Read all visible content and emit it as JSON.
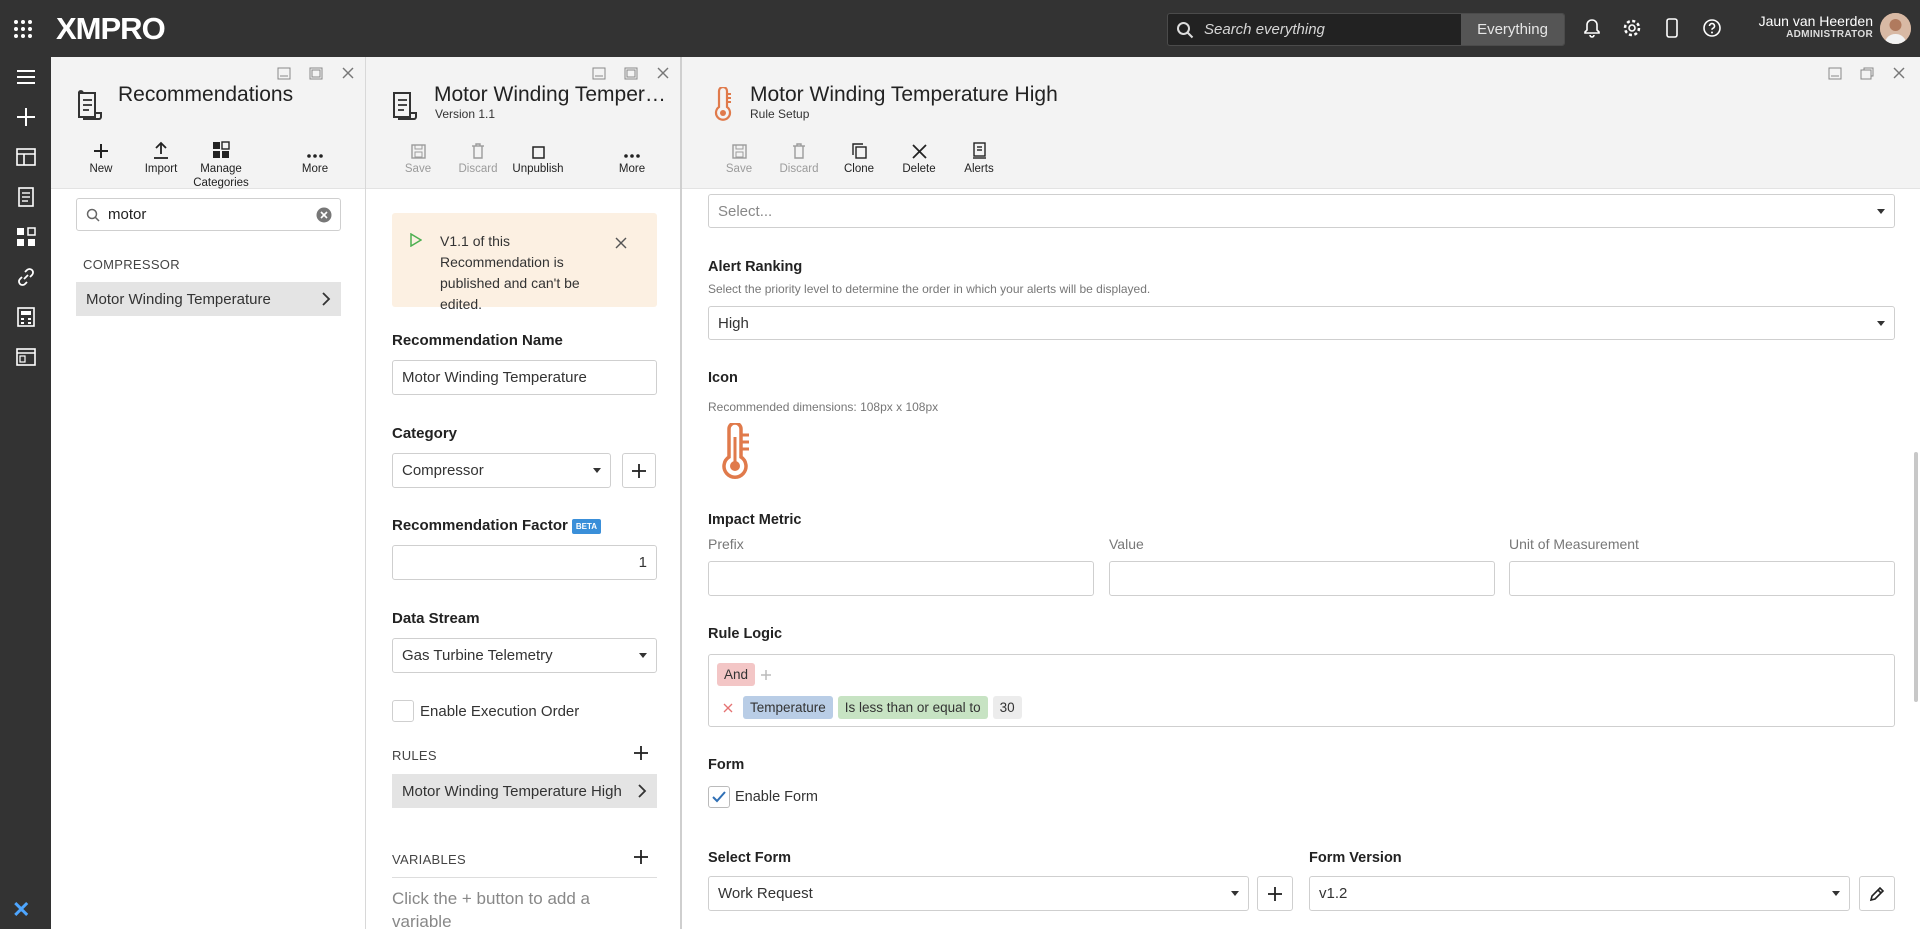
{
  "app": {
    "logo": "XMPRO"
  },
  "topbar": {
    "search_placeholder": "Search everything",
    "search_scope": "Everything",
    "user_name": "Jaun van Heerden",
    "user_role": "ADMINISTRATOR"
  },
  "recommendations_panel": {
    "title": "Recommendations",
    "toolbar": {
      "new": "New",
      "import": "Import",
      "manage_categories": "Manage Categories",
      "more": "More"
    },
    "search_value": "motor",
    "group": "COMPRESSOR",
    "items": [
      "Motor Winding Temperature"
    ]
  },
  "recommendation_panel": {
    "title": "Motor Winding Temper…",
    "version": "Version 1.1",
    "toolbar": {
      "save": "Save",
      "discard": "Discard",
      "unpublish": "Unpublish",
      "more": "More"
    },
    "banner": "V1.1 of this Recommendation is published and can't be edited.",
    "name_label": "Recommendation Name",
    "name_value": "Motor Winding Temperature",
    "category_label": "Category",
    "category_value": "Compressor",
    "factor_label": "Recommendation Factor",
    "factor_badge": "BETA",
    "factor_value": "1",
    "stream_label": "Data Stream",
    "stream_value": "Gas Turbine Telemetry",
    "exec_order_label": "Enable Execution Order",
    "rules_label": "RULES",
    "rules": [
      "Motor Winding Temperature High"
    ],
    "variables_label": "VARIABLES",
    "variables_empty": "Click the + button to add a variable"
  },
  "rule_panel": {
    "title": "Motor Winding Temperature High",
    "subtitle": "Rule Setup",
    "toolbar": {
      "save": "Save",
      "discard": "Discard",
      "clone": "Clone",
      "delete": "Delete",
      "alerts": "Alerts"
    },
    "top_select_placeholder": "Select...",
    "alert_ranking_label": "Alert Ranking",
    "alert_ranking_hint": "Select the priority level to determine the order in which your alerts will be displayed.",
    "alert_ranking_value": "High",
    "icon_label": "Icon",
    "icon_hint": "Recommended dimensions: 108px x 108px",
    "impact_label": "Impact Metric",
    "impact_prefix": "Prefix",
    "impact_value": "Value",
    "impact_unit": "Unit of Measurement",
    "rule_logic_label": "Rule Logic",
    "logic_operator": "And",
    "condition": {
      "field": "Temperature",
      "operator": "Is less than or equal to",
      "value": "30"
    },
    "form_label": "Form",
    "enable_form_label": "Enable Form",
    "select_form_label": "Select Form",
    "select_form_value": "Work Request",
    "form_version_label": "Form Version",
    "form_version_value": "v1.2"
  },
  "colors": {
    "accent": "#e07a4b",
    "topbar": "#333333",
    "chip_and": "#f3c6c6",
    "chip_field": "#b9cde6",
    "chip_op": "#c7e3c3"
  }
}
